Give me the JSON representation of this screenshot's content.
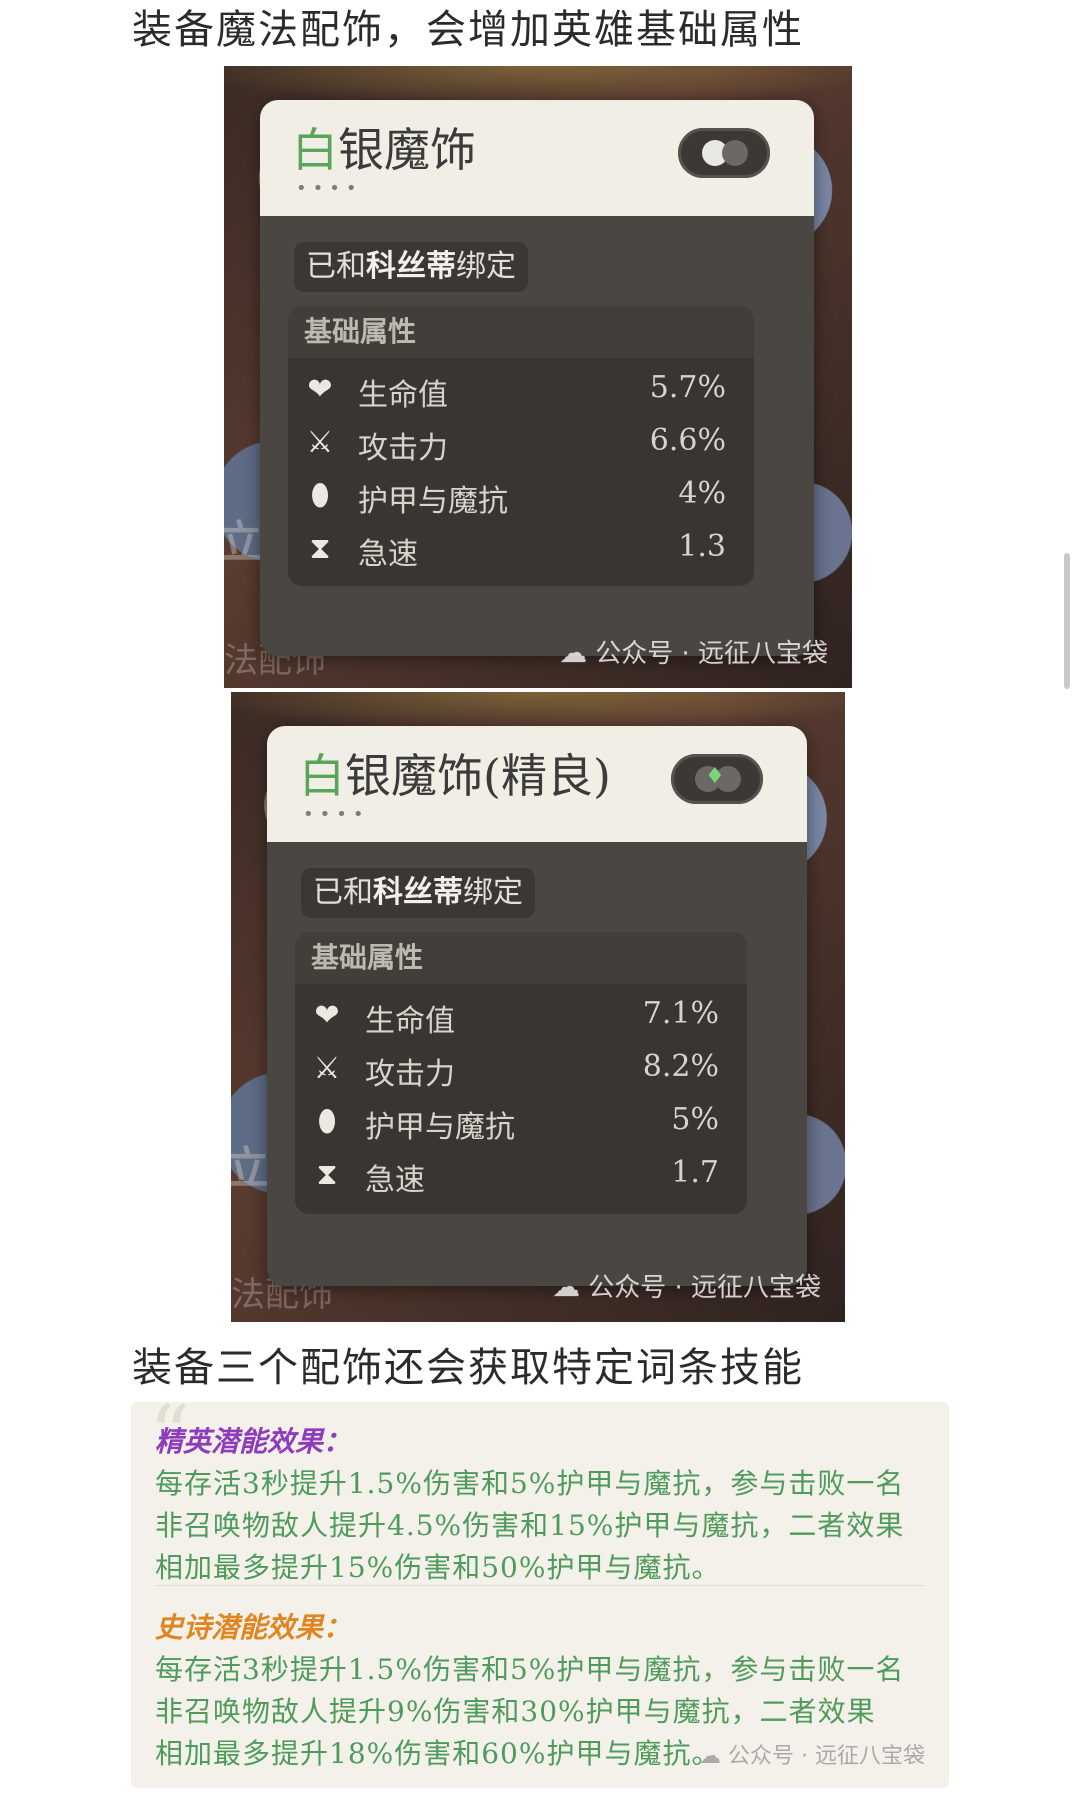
{
  "intro_text": "装备魔法配饰，会增加英雄基础属性",
  "cards": [
    {
      "title_first": "白",
      "title_rest": "银魔饰",
      "dots": "••••",
      "bound_prefix": "已和",
      "bound_name": "科丝蒂",
      "bound_suffix": "绑定",
      "section_title": "基础属性",
      "stats": [
        {
          "icon": "heart-icon",
          "name": "生命值",
          "value": "5.7%"
        },
        {
          "icon": "sword-icon",
          "name": "攻击力",
          "value": "6.6%"
        },
        {
          "icon": "shield-icon",
          "name": "护甲与魔抗",
          "value": "4%"
        },
        {
          "icon": "hourglass-icon",
          "name": "急速",
          "value": "1.3"
        }
      ],
      "ghost_left": "立白",
      "ghost_bottom": "法配饰",
      "watermark": "公众号 · 远征八宝袋"
    },
    {
      "title_first": "白",
      "title_rest": "银魔饰(精良)",
      "dots": "••••",
      "bound_prefix": "已和",
      "bound_name": "科丝蒂",
      "bound_suffix": "绑定",
      "section_title": "基础属性",
      "stats": [
        {
          "icon": "heart-icon",
          "name": "生命值",
          "value": "7.1%"
        },
        {
          "icon": "sword-icon",
          "name": "攻击力",
          "value": "8.2%"
        },
        {
          "icon": "shield-icon",
          "name": "护甲与魔抗",
          "value": "5%"
        },
        {
          "icon": "hourglass-icon",
          "name": "急速",
          "value": "1.7"
        }
      ],
      "ghost_left": "立白",
      "ghost_bottom": "法配饰",
      "watermark": "公众号 · 远征八宝袋"
    }
  ],
  "mid_text": "装备三个配饰还会获取特定词条技能",
  "potential": {
    "elite_label": "精英潜能效果：",
    "elite_lines": [
      "每存活3秒提升1.5%伤害和5%护甲与魔抗，参与击败一名",
      "非召唤物敌人提升4.5%伤害和15%护甲与魔抗，二者效果",
      "相加最多提升15%伤害和50%护甲与魔抗。"
    ],
    "epic_label": "史诗潜能效果：",
    "epic_lines": [
      "每存活3秒提升1.5%伤害和5%护甲与魔抗，参与击败一名",
      "非召唤物敌人提升9%伤害和30%护甲与魔抗，二者效果",
      "相加最多提升18%伤害和60%护甲与魔抗。"
    ],
    "watermark": "公众号 · 远征八宝袋"
  },
  "colors": {
    "title_green": "#5aa55a",
    "elite_purple": "#8f3bbd",
    "epic_orange": "#df8622",
    "effect_green": "#4f9b5b"
  }
}
